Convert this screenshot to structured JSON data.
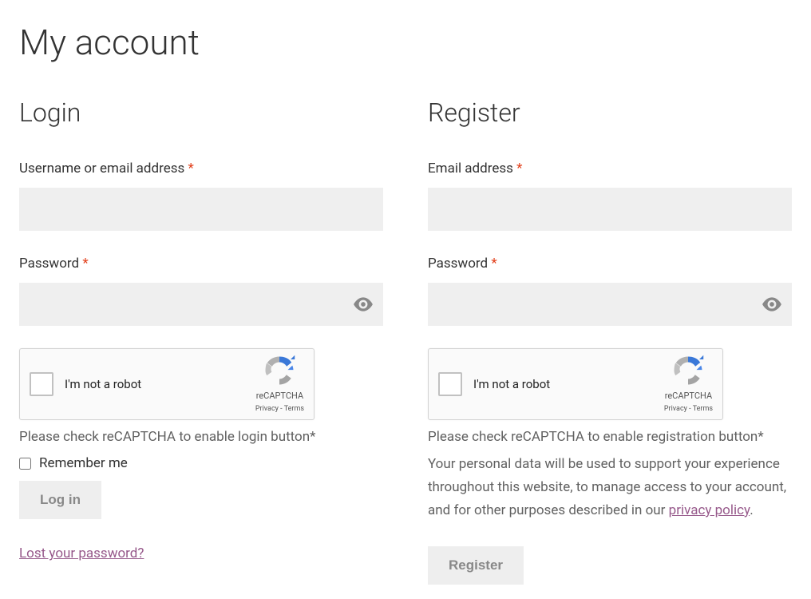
{
  "page": {
    "title": "My account"
  },
  "login": {
    "heading": "Login",
    "username_label": "Username or email address ",
    "password_label": "Password ",
    "recaptcha_label": "I'm not a robot",
    "recaptcha_brand": "reCAPTCHA",
    "recaptcha_links": "Privacy - Terms",
    "recaptcha_hint": "Please check reCAPTCHA to enable login button*",
    "remember_label": "Remember me",
    "button_label": "Log in",
    "lost_password": "Lost your password?"
  },
  "register": {
    "heading": "Register",
    "email_label": "Email address ",
    "password_label": "Password ",
    "recaptcha_label": "I'm not a robot",
    "recaptcha_brand": "reCAPTCHA",
    "recaptcha_links": "Privacy - Terms",
    "recaptcha_hint": "Please check reCAPTCHA to enable registration button*",
    "privacy_text_before": "Your personal data will be used to support your experience throughout this website, to manage access to your account, and for other purposes described in our ",
    "privacy_link": "privacy policy",
    "privacy_text_after": ".",
    "button_label": "Register"
  },
  "required_marker": "*"
}
